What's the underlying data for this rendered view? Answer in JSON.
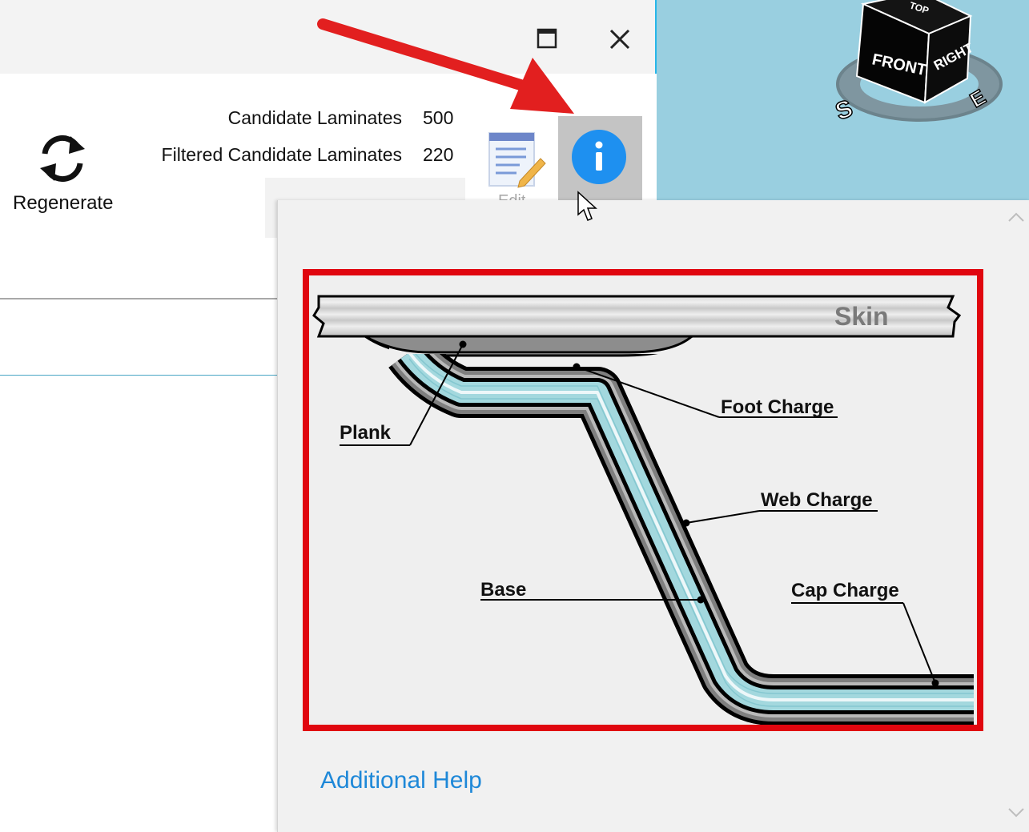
{
  "toolbar": {
    "regenerate_label": "Regenerate",
    "stats": [
      {
        "label": "Candidate Laminates",
        "value": "500"
      },
      {
        "label": "Filtered Candidate Laminates",
        "value": "220"
      }
    ],
    "edit_label": "Edit",
    "info_icon": "info-icon"
  },
  "viewcube": {
    "faces": {
      "front": "FRONT",
      "right": "RIGHT",
      "top": "TOP"
    },
    "compass": {
      "south": "S",
      "east": "E"
    }
  },
  "help_popup": {
    "diagram": {
      "skin": "Skin",
      "labels": {
        "foot_charge": "Foot Charge",
        "plank": "Plank",
        "web_charge": "Web Charge",
        "base": "Base",
        "cap_charge": "Cap Charge"
      }
    },
    "link": "Additional Help"
  },
  "colors": {
    "accent_blue": "#1e88d8",
    "info_button": "#1e90f0",
    "highlight_red": "#e0060f",
    "charge_cyan": "#9fd8e0"
  }
}
